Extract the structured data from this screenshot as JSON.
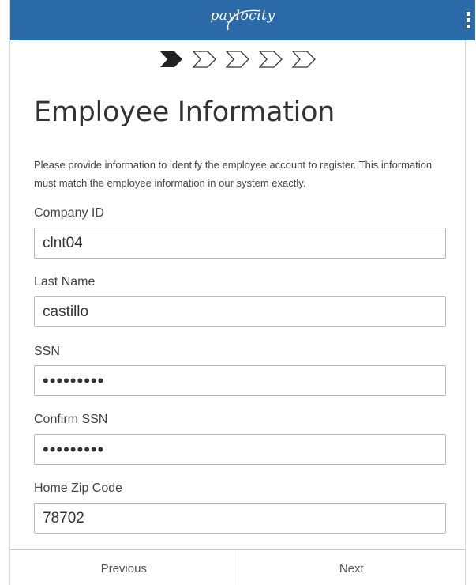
{
  "header": {
    "logo_text": "paylocity",
    "menu_icon": "kebab-menu-icon",
    "background_color": "#2a6aa8"
  },
  "progress": {
    "total_steps": 5,
    "current_step": 1,
    "active_color": "#222222",
    "inactive_color": "#333333"
  },
  "page": {
    "title": "Employee Information",
    "description": "Please provide information to identify the employee account to register. This information must match the employee information in our system exactly."
  },
  "form": {
    "company_id": {
      "label": "Company ID",
      "value": "clnt04"
    },
    "last_name": {
      "label": "Last Name",
      "value": "castillo"
    },
    "ssn": {
      "label": "SSN",
      "value": "•••••••••"
    },
    "confirm_ssn": {
      "label": "Confirm SSN",
      "value": "•••••••••"
    },
    "home_zip": {
      "label": "Home Zip Code",
      "value": "78702"
    }
  },
  "footer": {
    "previous_label": "Previous",
    "next_label": "Next"
  }
}
